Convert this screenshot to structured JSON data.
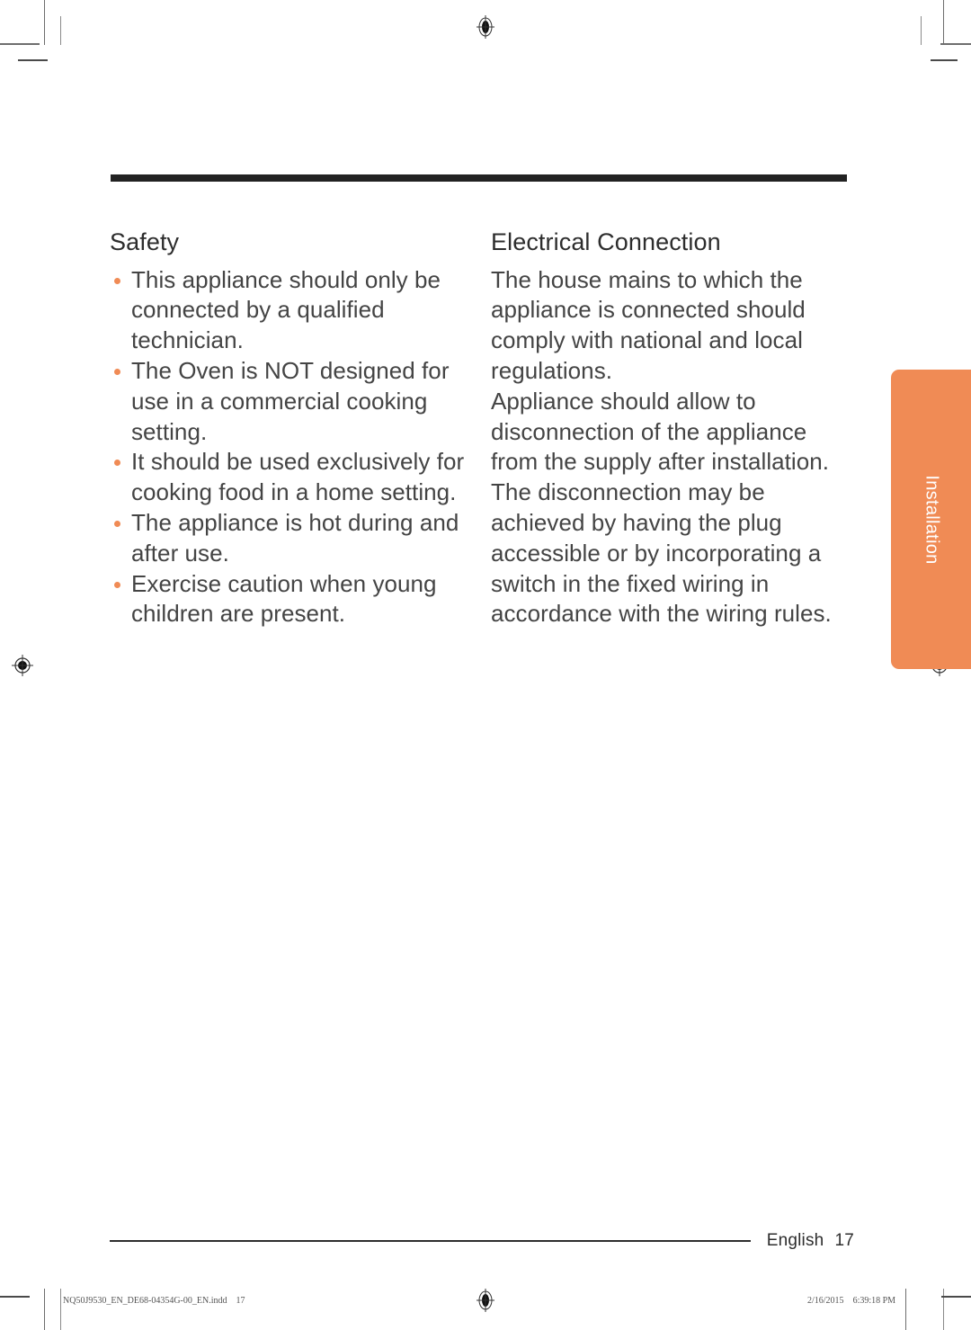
{
  "document": {
    "type": "appliance-manual-page",
    "language_label": "English",
    "page_number": "17",
    "side_tab_label": "Installation",
    "accent_color": "#F08B55",
    "rule_color": "#222222",
    "text_color": "#444444"
  },
  "sections": [
    {
      "id": "safety",
      "title": "Safety",
      "bullets": [
        "This appliance should only be connected by a qualified technician.",
        "The Oven is NOT designed for use in a commercial cooking setting.",
        "It should be used exclusively for cooking food in a home setting.",
        "The appliance is hot during and after use.",
        "Exercise caution when young children are present."
      ]
    },
    {
      "id": "electrical-connection",
      "title": "Electrical Connection",
      "paragraphs": [
        "The house mains to which the appliance is connected should comply with national and local regulations.",
        "Appliance should allow to disconnection of the appliance from the supply after installation. The disconnection may be achieved by having the plug accessible or by incorporating a switch in the fixed wiring in accordance with the wiring rules."
      ]
    }
  ],
  "footer": {
    "language": "English",
    "page": "17"
  },
  "print_slug": {
    "filename": "NQ50J9530_EN_DE68-04354G-00_EN.indd",
    "page": "17",
    "date": "2/16/2015",
    "time": "6:39:18 PM"
  }
}
